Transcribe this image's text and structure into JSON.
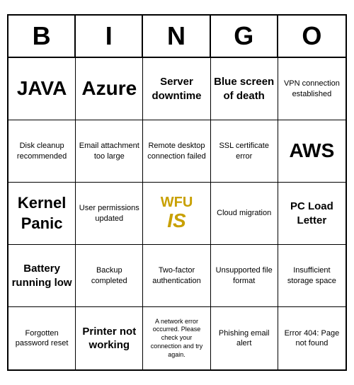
{
  "header": {
    "letters": [
      "B",
      "I",
      "N",
      "G",
      "O"
    ]
  },
  "cells": [
    {
      "text": "JAVA",
      "size": "xlarge"
    },
    {
      "text": "Azure",
      "size": "xlarge"
    },
    {
      "text": "Server downtime",
      "size": "medium"
    },
    {
      "text": "Blue screen of death",
      "size": "medium"
    },
    {
      "text": "VPN connection established",
      "size": "small"
    },
    {
      "text": "Disk cleanup recommended",
      "size": "small"
    },
    {
      "text": "Email attachment too large",
      "size": "small"
    },
    {
      "text": "Remote desktop connection failed",
      "size": "small"
    },
    {
      "text": "SSL certificate error",
      "size": "small"
    },
    {
      "text": "AWS",
      "size": "xlarge"
    },
    {
      "text": "Kernel Panic",
      "size": "large"
    },
    {
      "text": "User permissions updated",
      "size": "small"
    },
    {
      "text": "WFU_IS",
      "size": "wfu"
    },
    {
      "text": "Cloud migration",
      "size": "small"
    },
    {
      "text": "PC Load Letter",
      "size": "medium"
    },
    {
      "text": "Battery running low",
      "size": "medium"
    },
    {
      "text": "Backup completed",
      "size": "small"
    },
    {
      "text": "Two-factor authentication",
      "size": "small"
    },
    {
      "text": "Unsupported file format",
      "size": "small"
    },
    {
      "text": "Insufficient storage space",
      "size": "small"
    },
    {
      "text": "Forgotten password reset",
      "size": "small"
    },
    {
      "text": "Printer not working",
      "size": "medium"
    },
    {
      "text": "A network error occurred. Please check your connection and try again.",
      "size": "tiny"
    },
    {
      "text": "Phishing email alert",
      "size": "small"
    },
    {
      "text": "Error 404: Page not found",
      "size": "small"
    }
  ]
}
